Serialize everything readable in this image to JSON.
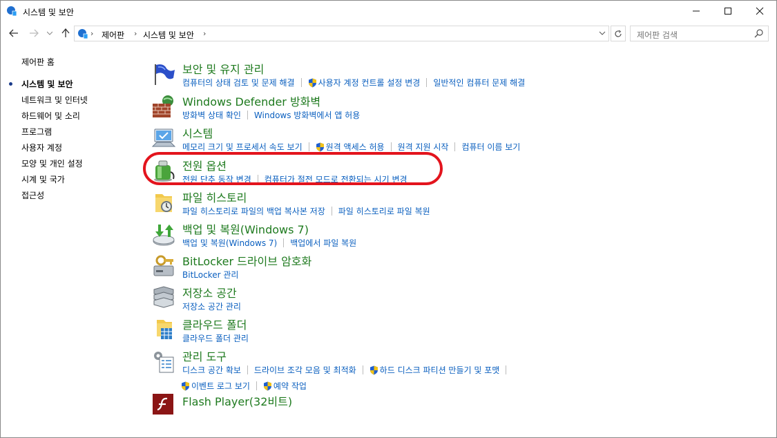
{
  "window": {
    "title": "시스템 및 보안",
    "controls": {
      "minimize": "─",
      "maximize": "☐",
      "close": "✕"
    }
  },
  "nav": {
    "breadcrumbs": [
      "제어판",
      "시스템 및 보안"
    ],
    "search_placeholder": "제어판 검색"
  },
  "sidebar": {
    "home": "제어판 홈",
    "items": [
      {
        "label": "시스템 및 보안",
        "current": true
      },
      {
        "label": "네트워크 및 인터넷"
      },
      {
        "label": "하드웨어 및 소리"
      },
      {
        "label": "프로그램"
      },
      {
        "label": "사용자 계정"
      },
      {
        "label": "모양 및 개인 설정"
      },
      {
        "label": "시계 및 국가"
      },
      {
        "label": "접근성"
      }
    ]
  },
  "categories": [
    {
      "title": "보안 및 유지 관리",
      "icon": "flag-icon",
      "links": [
        "컴퓨터의 상태 검토 및 문제 해결",
        "사용자 계정 컨트롤 설정 변경",
        "일반적인 컴퓨터 문제 해결"
      ]
    },
    {
      "title": "Windows Defender 방화벽",
      "icon": "firewall-icon",
      "links": [
        "방화벽 상태 확인",
        "Windows 방화벽에서 앱 허용"
      ]
    },
    {
      "title": "시스템",
      "icon": "computer-icon",
      "links": [
        "메모리 크기 및 프로세서 속도 보기",
        "원격 액세스 허용",
        "원격 지원 시작",
        "컴퓨터 이름 보기"
      ]
    },
    {
      "title": "전원 옵션",
      "icon": "power-icon",
      "links": [
        "전원 단추 동작 변경",
        "컴퓨터가 절전 모드로 전환되는 시기 변경"
      ]
    },
    {
      "title": "파일 히스토리",
      "icon": "file-history-icon",
      "links": [
        "파일 히스토리로 파일의 백업 복사본 저장",
        "파일 히스토리로 파일 복원"
      ]
    },
    {
      "title": "백업 및 복원(Windows 7)",
      "icon": "backup-icon",
      "links": [
        "백업 및 복원(Windows 7)",
        "백업에서 파일 복원"
      ]
    },
    {
      "title": "BitLocker 드라이브 암호화",
      "icon": "bitlocker-icon",
      "links": [
        "BitLocker 관리"
      ]
    },
    {
      "title": "저장소 공간",
      "icon": "storage-icon",
      "links": [
        "저장소 공간 관리"
      ]
    },
    {
      "title": "클라우드 폴더",
      "icon": "cloud-folder-icon",
      "links": [
        "클라우드 폴더 관리"
      ]
    },
    {
      "title": "관리 도구",
      "icon": "admin-tools-icon",
      "links": [
        "디스크 공간 확보",
        "드라이브 조각 모음 및 최적화",
        "하드 디스크 파티션 만들기 및 포맷"
      ],
      "links2": [
        "이벤트 로그 보기",
        "예약 작업"
      ]
    },
    {
      "title": "Flash Player(32비트)",
      "icon": "flash-icon",
      "links": []
    }
  ],
  "colors": {
    "accent_link": "#0a5fbf",
    "category_title": "#1e7a1e",
    "highlight": "#e3141d"
  }
}
